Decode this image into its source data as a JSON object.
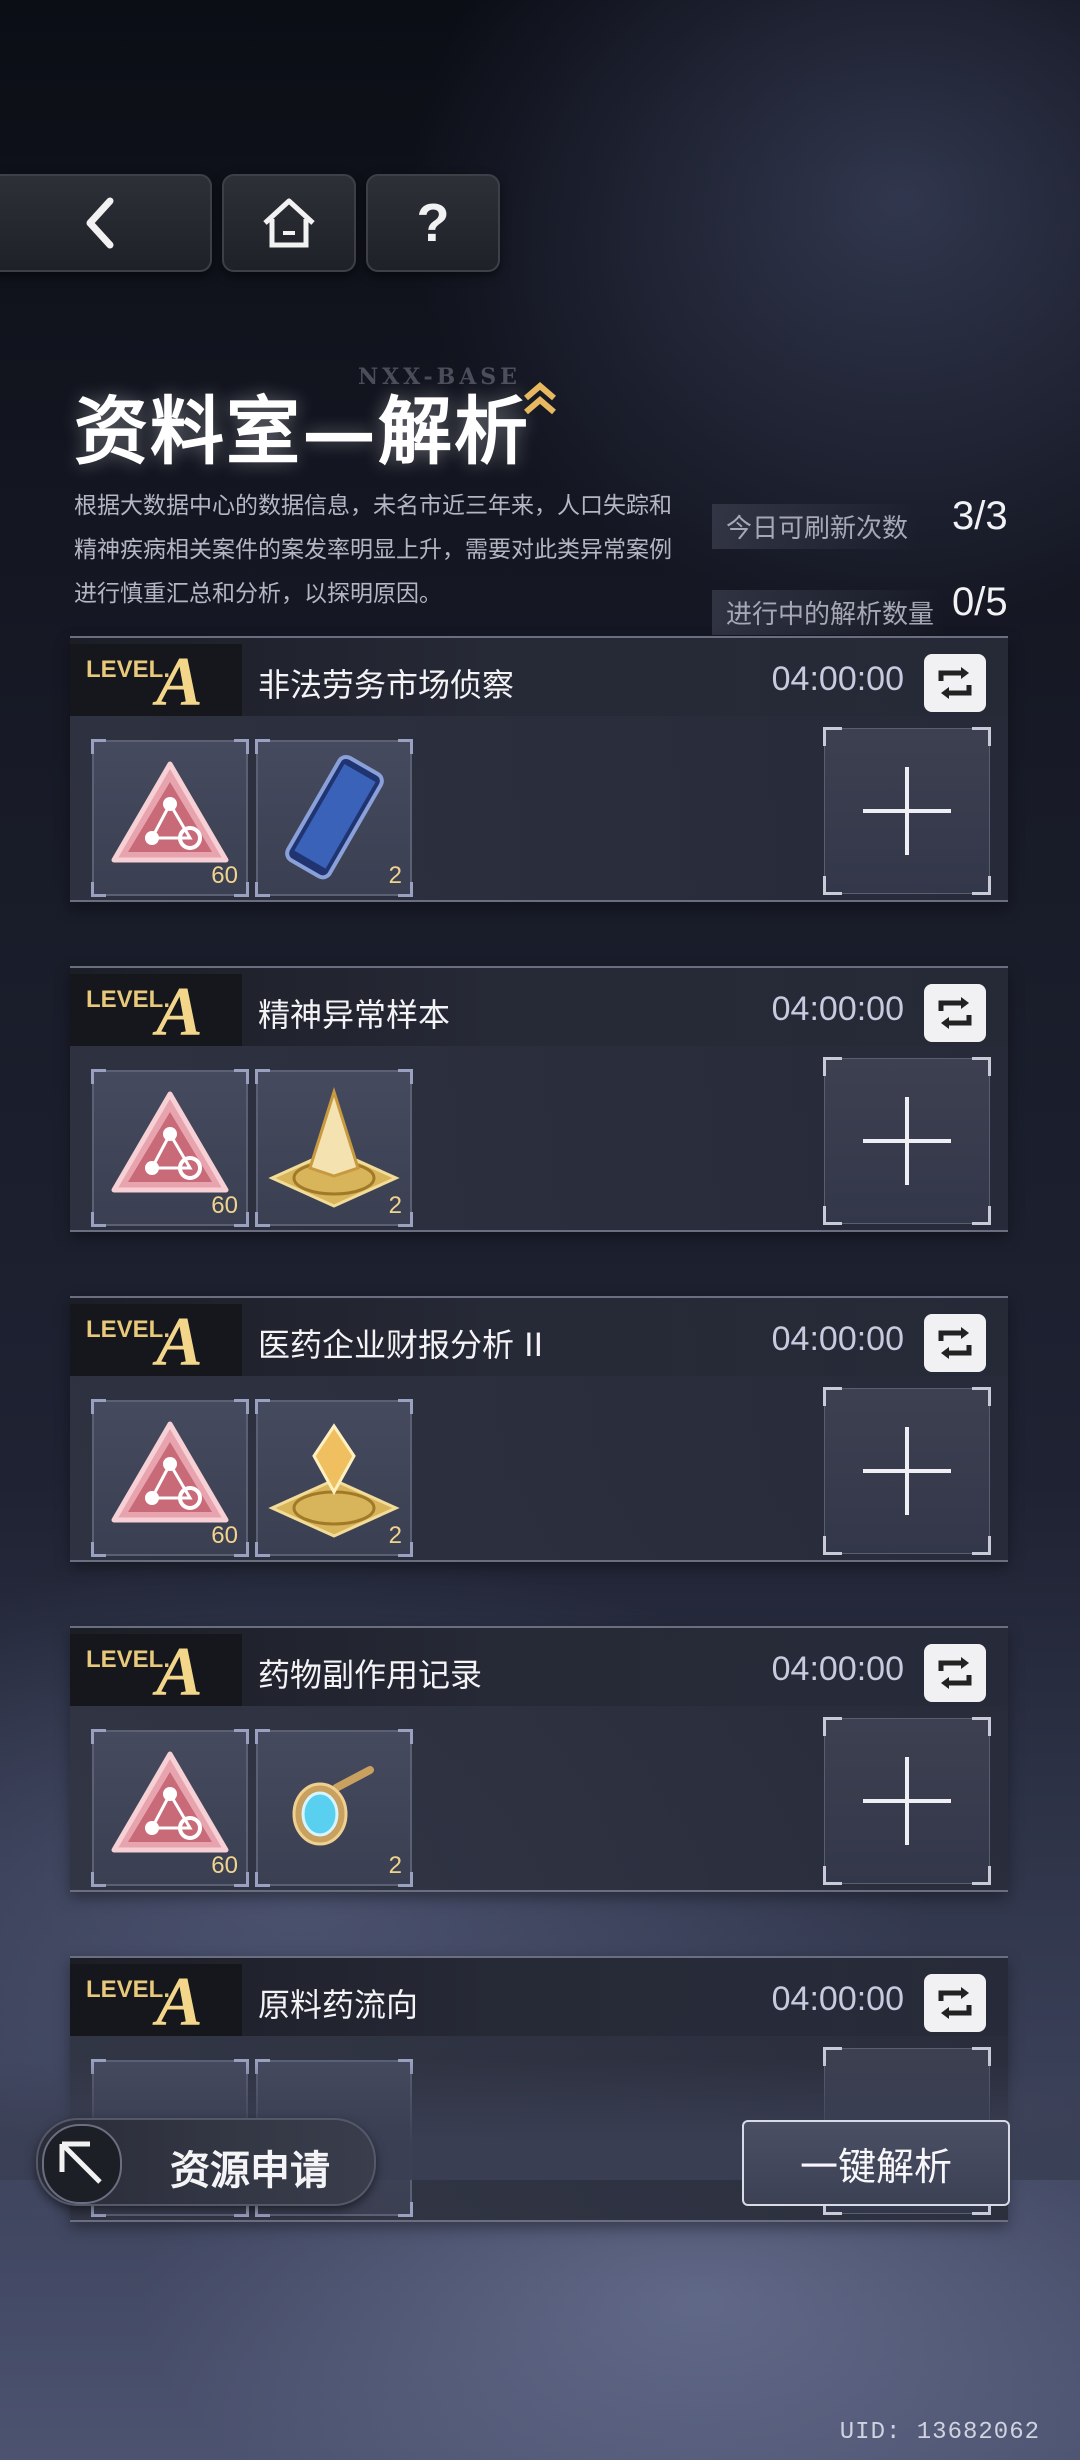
{
  "nav": {
    "help_label": "?"
  },
  "header": {
    "watermark": "NXX-BASE",
    "title": "资料室—解析",
    "description": "根据大数据中心的数据信息，未名市近三年来，人口失踪和精神疾病相关案件的案发率明显上升，需要对此类异常案例进行慎重汇总和分析，以探明原因。",
    "refresh_label": "今日可刷新次数",
    "refresh_value": "3/3",
    "progress_label": "进行中的解析数量",
    "progress_value": "0/5"
  },
  "cards": [
    {
      "level": "LEVEL.",
      "grade": "A",
      "title": "非法劳务市场侦察",
      "timer": "04:00:00",
      "item1_qty": "60",
      "item2_qty": "2",
      "item2_icon": "phone-icon"
    },
    {
      "level": "LEVEL.",
      "grade": "A",
      "title": "精神异常样本",
      "timer": "04:00:00",
      "item1_qty": "60",
      "item2_qty": "2",
      "item2_icon": "gold-pyramid-icon"
    },
    {
      "level": "LEVEL.",
      "grade": "A",
      "title": "医药企业财报分析 II",
      "timer": "04:00:00",
      "item1_qty": "60",
      "item2_qty": "2",
      "item2_icon": "gold-crystal-icon"
    },
    {
      "level": "LEVEL.",
      "grade": "A",
      "title": "药物副作用记录",
      "timer": "04:00:00",
      "item1_qty": "60",
      "item2_qty": "2",
      "item2_icon": "gem-pin-icon"
    },
    {
      "level": "LEVEL.",
      "grade": "A",
      "title": "原料药流向",
      "timer": "04:00:00"
    }
  ],
  "footer": {
    "resource_label": "资源申请",
    "oneclick_label": "一键解析",
    "uid": "UID: 13682062"
  },
  "colors": {
    "gold": "#f3d68a",
    "title_white": "#ffffff",
    "card_bg": "#30344a"
  }
}
